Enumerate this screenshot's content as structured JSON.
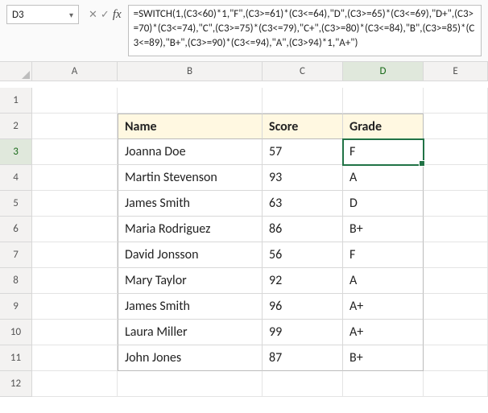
{
  "namebox": {
    "value": "D3"
  },
  "fx": {
    "x": "✕",
    "check": "✓",
    "fx": "fx"
  },
  "formula": "=SWITCH(1,(C3<60)*1,\"F\",(C3>=61)*(C3<=64),\"D\",(C3>=65)*(C3<=69),\"D+\",(C3>=70)*(C3<=74),\"C\",(C3>=75)*(C3<=79),\"C+\",(C3>=80)*(C3<=84),\"B\",(C3>=85)*(C3<=89),\"B+\",(C3>=90)*(C3<=94),\"A\",(C3>94)*1,\"A+\")",
  "cols": [
    "A",
    "B",
    "C",
    "D",
    "E"
  ],
  "rows": [
    "1",
    "2",
    "3",
    "4",
    "5",
    "6",
    "7",
    "8",
    "9",
    "10",
    "11",
    "12"
  ],
  "headers": {
    "name": "Name",
    "score": "Score",
    "grade": "Grade"
  },
  "data": [
    {
      "name": "Joanna Doe",
      "score": "57",
      "grade": "F"
    },
    {
      "name": "Martin Stevenson",
      "score": "93",
      "grade": "A"
    },
    {
      "name": "James Smith",
      "score": "63",
      "grade": "D"
    },
    {
      "name": "Maria Rodriguez",
      "score": "86",
      "grade": "B+"
    },
    {
      "name": "David Jonsson",
      "score": "56",
      "grade": "F"
    },
    {
      "name": "Mary Taylor",
      "score": "92",
      "grade": "A"
    },
    {
      "name": "James Smith",
      "score": "96",
      "grade": "A+"
    },
    {
      "name": "Laura Miller",
      "score": "99",
      "grade": "A+"
    },
    {
      "name": "John Jones",
      "score": "87",
      "grade": "B+"
    }
  ],
  "activeCol": "D",
  "activeRow": "3"
}
